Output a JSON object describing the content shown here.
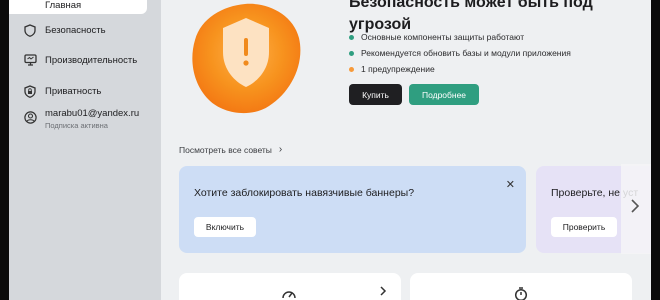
{
  "sidebar": {
    "items": [
      {
        "label": "Главная",
        "icon": "home-icon"
      },
      {
        "label": "Безопасность",
        "icon": "shield-icon"
      },
      {
        "label": "Производительность",
        "icon": "monitor-icon"
      },
      {
        "label": "Приватность",
        "icon": "privacy-lock-icon"
      }
    ],
    "account": {
      "name": "marabu01@yandex.ru",
      "status": "Подписка активна",
      "icon": "user-icon"
    }
  },
  "hero": {
    "title_line1": "Безопасность может быть под",
    "title_line2": "угрозой",
    "items": [
      {
        "text": "Основные компоненты защиты работают",
        "color": "#2f9e80"
      },
      {
        "text": "Рекомендуется обновить базы и модули приложения",
        "color": "#2f9e80"
      },
      {
        "text": "1 предупреждение",
        "color": "#f79a3a"
      }
    ],
    "buy_label": "Купить",
    "more_label": "Подробнее",
    "shield_icon": "warning-shield-icon",
    "accent": "#f7931e"
  },
  "tips": {
    "label": "Посмотреть все советы",
    "icon": "chevron-right-icon"
  },
  "cards": {
    "banner": {
      "title": "Хотите заблокировать навязчивые баннеры?",
      "button": "Включить",
      "close_icon": "close-icon"
    },
    "check": {
      "title": "Проверьте, не уст",
      "button": "Проверить"
    }
  },
  "bottom": {
    "icon1": "speed-icon",
    "icon2": "timer-icon",
    "arrow": "chevron-right-icon"
  }
}
